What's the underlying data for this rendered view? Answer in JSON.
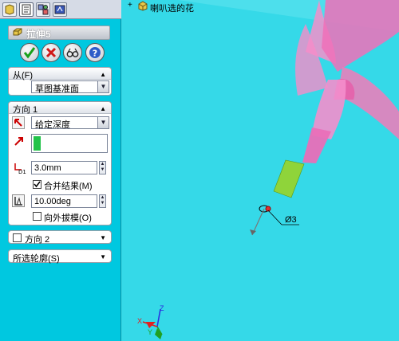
{
  "tabs": [
    {
      "icon": "feature-manager-icon"
    },
    {
      "icon": "property-manager-icon"
    },
    {
      "icon": "configuration-manager-icon"
    },
    {
      "icon": "dimxpert-icon"
    }
  ],
  "feature": {
    "title": "拉伸5",
    "icon": "extrude-icon"
  },
  "actions": [
    {
      "name": "ok",
      "icon": "check-icon"
    },
    {
      "name": "cancel",
      "icon": "x-icon"
    },
    {
      "name": "preview",
      "icon": "glasses-icon"
    },
    {
      "name": "help",
      "icon": "help-icon"
    }
  ],
  "from_group": {
    "title": "从(F)",
    "selected": "草图基准面"
  },
  "direction1": {
    "title": "方向 1",
    "end_condition": "给定深度",
    "depth": "3.0mm",
    "merge_label": "合并结果(M)",
    "merge_checked": true,
    "draft": "10.00deg",
    "draft_outward_label": "向外拔模(O)",
    "draft_outward_checked": false
  },
  "direction2": {
    "title": "方向 2",
    "checked": false
  },
  "selected_contours": {
    "title": "所选轮廓(S)"
  },
  "tree": {
    "root_label": "喇叭选的花"
  },
  "dimension": {
    "label": "Ø3"
  },
  "triad": {
    "x": "X",
    "y": "Y",
    "z": "Z"
  },
  "colors": {
    "panel_bg": "#00c8e0",
    "viewport_bg": "#35d9e8",
    "petal": "#f07ab8",
    "stem": "#8fd43a",
    "depth_swatch": "#22c34a"
  }
}
